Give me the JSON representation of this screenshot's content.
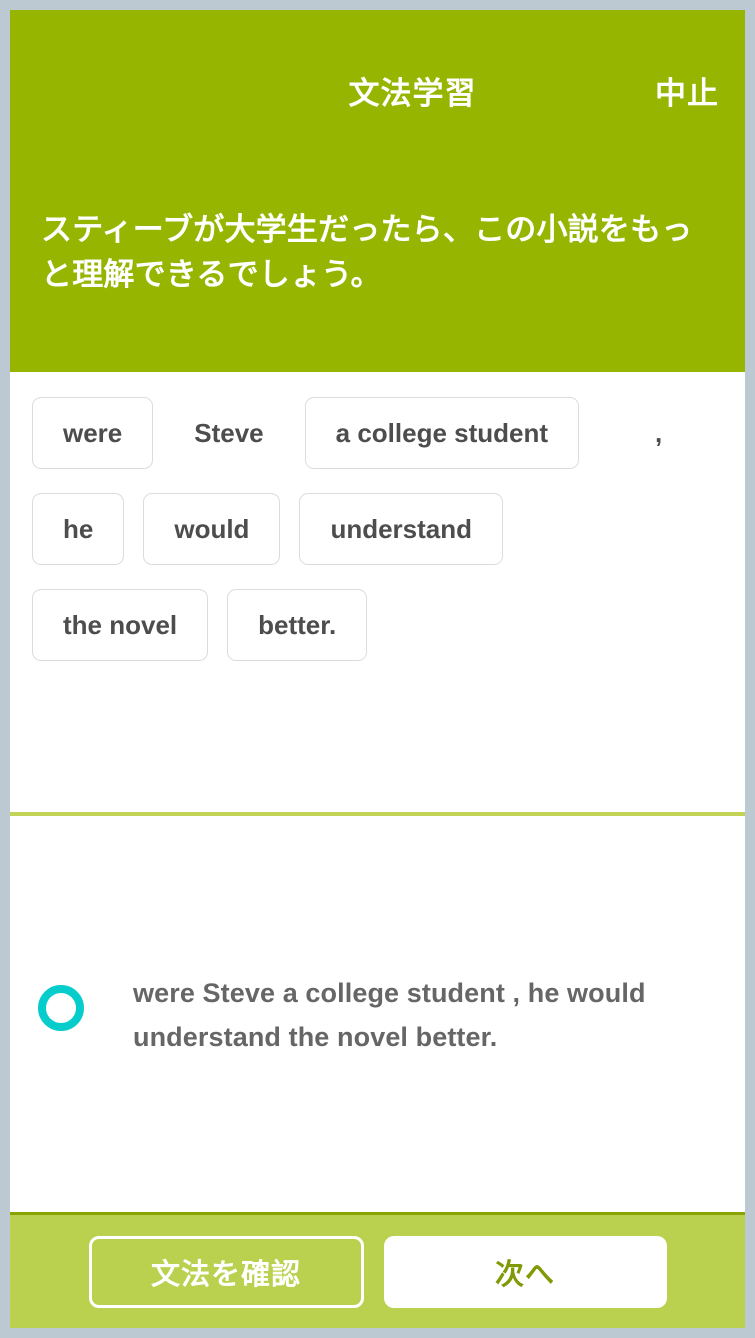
{
  "header": {
    "title": "文法学習",
    "cancel_label": "中止",
    "prompt": "スティーブが大学生だったら、この小説をもっと理解できるでしょう。",
    "background_color": "#95b500",
    "text_color": "#ffffff"
  },
  "tiles": {
    "rows": [
      [
        {
          "label": "were",
          "type": "tile"
        },
        {
          "label": "Steve",
          "type": "plain"
        },
        {
          "label": "a college student",
          "type": "tile"
        },
        {
          "label": ",",
          "type": "punct"
        }
      ],
      [
        {
          "label": "he",
          "type": "tile"
        },
        {
          "label": "would",
          "type": "tile"
        },
        {
          "label": "understand",
          "type": "tile"
        }
      ],
      [
        {
          "label": "the novel",
          "type": "tile"
        },
        {
          "label": "better.",
          "type": "tile"
        }
      ]
    ],
    "tile_border_color": "#dcdcdc",
    "tile_text_color": "#4d4d4d"
  },
  "divider": {
    "color": "#c3d355"
  },
  "answer": {
    "marker_icon": "circle-outline-icon",
    "marker_color": "#06cccc",
    "text": "were Steve a college student , he would understand the novel better.",
    "text_color": "#666666"
  },
  "footer": {
    "background_color": "#bad14f",
    "check_grammar_label": "文法を確認",
    "next_label": "次へ",
    "next_text_color": "#7f9a05"
  },
  "frame": {
    "border_color": "#bcc8d2"
  }
}
